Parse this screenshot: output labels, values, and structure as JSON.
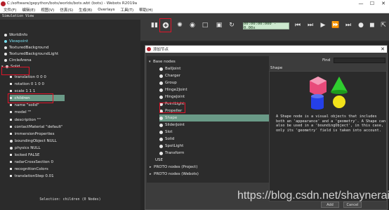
{
  "window": {
    "title": "C:/software/gepython/bots/worlds/bots.wbt (bots) - Webots R2019a",
    "controls": [
      "—",
      "☐",
      "✕"
    ]
  },
  "menu": [
    "文件(F)",
    "编辑(E)",
    "视图(V)",
    "仿真(S)",
    "生成(B)",
    "Overlays",
    "工具(T)",
    "帮助(H)"
  ],
  "simulation_view": {
    "label": "Simulation View"
  },
  "toolbar": {
    "time": "00:00:00:000 - 0.00x",
    "icons": [
      "panel-toggle-icon",
      "add-node-icon",
      "animation-icon",
      "view-icon",
      "open-world-icon",
      "save-world-icon",
      "revert-icon",
      "step-back-icon",
      "step-icon",
      "play-icon",
      "fast-icon",
      "fastest-icon",
      "record-icon",
      "movie-icon",
      "share-icon"
    ]
  },
  "scene_tree": {
    "top_nodes": [
      {
        "label": "WorldInfo",
        "color": "#e8e8e8"
      },
      {
        "label": "Viewpoint",
        "color": "#79e0f0"
      },
      {
        "label": "TexturedBackground",
        "color": "#e8e8e8"
      },
      {
        "label": "TexturedBackgroundLight",
        "color": "#e8e8e8"
      },
      {
        "label": "CircleArena",
        "color": "#e8e8e8"
      }
    ],
    "solid": {
      "label": "Solid",
      "fields": [
        "translation 0 0 0",
        "rotation 0 1 0 0",
        "scale 1 1 1",
        "children",
        "name \"solid\"",
        "model \"\"",
        "description \"\"",
        "contactMaterial \"default\"",
        "immersionProperties",
        "boundingObject NULL",
        "physics NULL",
        "locked FALSE",
        "radarCrossSection 0",
        "recognitionColors",
        "translationStep 0.01"
      ]
    },
    "status": "Selection: children (0 Nodes)"
  },
  "dialog": {
    "title": "添加节点",
    "find_label": "Find",
    "find_value": "",
    "section": "Base nodes",
    "nodes": [
      "BallJoint",
      "Charger",
      "Group",
      "Hinge2Joint",
      "HingeJoint",
      "PointLight",
      "Propeller",
      "Shape",
      "SliderJoint",
      "Slot",
      "Solid",
      "SpotLight",
      "Transform"
    ],
    "selected_node": "Shape",
    "tail_items": [
      "USE",
      "PROTO nodes (Project)",
      "PROTO nodes (Webots)"
    ],
    "info_title": "Shape",
    "description": "A Shape node is a visual objects that includes both an 'appearance' and a 'geometry'. A Shape can also be used in a 'boundingObject', in this case, only its 'geometry' field is taken into account.",
    "buttons": [
      "Add",
      "Cancel"
    ],
    "colors": {
      "cube": "#e84a7a",
      "cone": "#2fce2f",
      "sphere": "#f2e21a",
      "cylinder": "#2540e8"
    }
  },
  "watermark": "https://blog.csdn.net/shaynerain",
  "highlight_color": "#e0152a"
}
